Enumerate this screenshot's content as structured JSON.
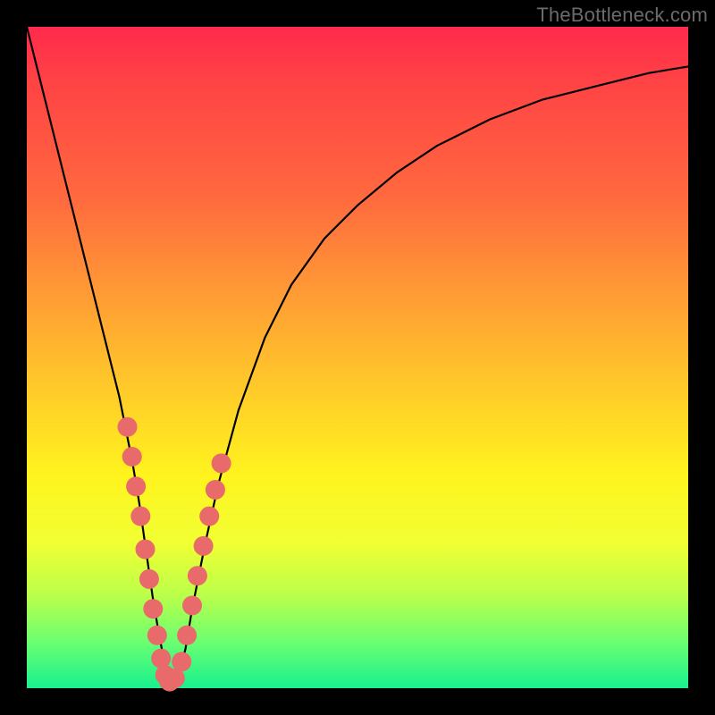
{
  "watermark": "TheBottleneck.com",
  "colors": {
    "dot": "#e86a6a",
    "curve": "#000000",
    "frame": "#000000"
  },
  "chart_data": {
    "type": "line",
    "title": "",
    "xlabel": "",
    "ylabel": "",
    "xlim": [
      0,
      100
    ],
    "ylim": [
      0,
      100
    ],
    "grid": false,
    "legend": false,
    "series": [
      {
        "name": "bottleneck-curve",
        "x": [
          0,
          2,
          4,
          6,
          8,
          10,
          12,
          14,
          16,
          17,
          18,
          19,
          20,
          21,
          22,
          23,
          24,
          25,
          27,
          29,
          32,
          36,
          40,
          45,
          50,
          56,
          62,
          70,
          78,
          86,
          94,
          100
        ],
        "y": [
          100,
          92,
          84,
          76,
          68,
          60,
          52,
          44,
          34,
          28,
          21,
          14,
          8,
          3,
          1,
          2,
          6,
          12,
          22,
          31,
          42,
          53,
          61,
          68,
          73,
          78,
          82,
          86,
          89,
          91,
          93,
          94
        ]
      }
    ],
    "markers": {
      "name": "highlighted-points",
      "x": [
        15.2,
        15.9,
        16.5,
        17.2,
        17.9,
        18.5,
        19.1,
        19.7,
        20.3,
        20.9,
        21.6,
        22.4,
        23.4,
        24.2,
        25.0,
        25.8,
        26.7,
        27.6,
        28.5,
        29.4
      ],
      "y": [
        39.5,
        35.0,
        30.5,
        26.0,
        21.0,
        16.5,
        12.0,
        8.0,
        4.5,
        2.0,
        1.0,
        1.5,
        4.0,
        8.0,
        12.5,
        17.0,
        21.5,
        26.0,
        30.0,
        34.0
      ]
    }
  }
}
